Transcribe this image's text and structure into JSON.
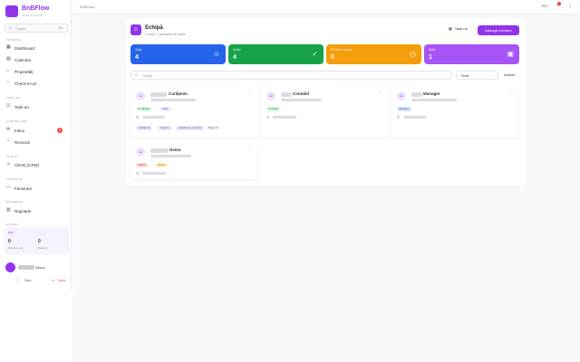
{
  "app": {
    "name": "BnBFlow",
    "tagline": "Cloud-ul locuinţei"
  },
  "topbar": {
    "breadcrumb": "BnBFlow",
    "lang": "RO"
  },
  "sidebar": {
    "search_placeholder": "Caută...",
    "shortcut": "⌘K",
    "sections": [
      "PRINCIPAL",
      "TASK-URI",
      "COMUNICARE",
      "CLIENȚI",
      "FINANCIAR",
      "RAPOARTE",
      "ECHIPĂ"
    ],
    "items": [
      {
        "label": "Dashboard",
        "icon": "dashboard-icon"
      },
      {
        "label": "Calendar",
        "icon": "calendar-icon"
      },
      {
        "label": "Proprietăți",
        "icon": "building-icon"
      },
      {
        "label": "Check-in-uri",
        "icon": "checkin-icon"
      },
      {
        "label": "Task-uri",
        "icon": "tasks-icon"
      },
      {
        "label": "Inbox",
        "icon": "inbox-icon",
        "badge": "3"
      },
      {
        "label": "Recenzii",
        "icon": "star-icon"
      },
      {
        "label": "Clienți (CRM)",
        "icon": "users-icon"
      },
      {
        "label": "Facturare",
        "icon": "invoice-icon"
      },
      {
        "label": "Rapoarte",
        "icon": "chart-icon"
      }
    ],
    "stats": {
      "title": "Azi",
      "value1": "0",
      "label1": "Check-in-uri",
      "value2": "0",
      "label2": "Task-uri"
    },
    "user": {
      "name": "Demo"
    },
    "theme_label": "Dark",
    "logout_label": "Ieșire"
  },
  "page": {
    "title": "Echipă",
    "subtitle": "4 activi, 1 persoane de ieșire",
    "tasks_button": "Task-uri",
    "add_button": "Adaugă membru"
  },
  "stats": [
    {
      "label": "Total",
      "value": "4",
      "color": "#2563eb",
      "icon": "team-icon"
    },
    {
      "label": "Activi",
      "value": "4",
      "color": "#16a34a",
      "icon": "check-icon"
    },
    {
      "label": "Pe teren acum",
      "value": "0",
      "color": "#f59e0b",
      "icon": "clock-icon"
    },
    {
      "label": "Staff",
      "value": "1",
      "color": "#a855f7",
      "icon": "briefcase-icon"
    }
  ],
  "search": {
    "placeholder": "Caută..."
  },
  "filter": {
    "value": "Toate"
  },
  "inactive_label": "Inactivi",
  "members": [
    {
      "name": "Curățenie",
      "tags": [
        "Curățenie",
        "Activ"
      ],
      "perms": [
        "curățenie",
        "lenjerie",
        "întreținere_curenţe",
        "Mai 4 zi"
      ]
    },
    {
      "name": "Contabil",
      "tags": [
        "Contabil"
      ],
      "perms": []
    },
    {
      "name": "Manager",
      "tags": [
        "Manager"
      ],
      "perms": []
    },
    {
      "name": "Demo",
      "tags": [
        "Admin",
        "Owner"
      ],
      "perms": []
    }
  ],
  "colors": {
    "accent": "#9333ea"
  }
}
